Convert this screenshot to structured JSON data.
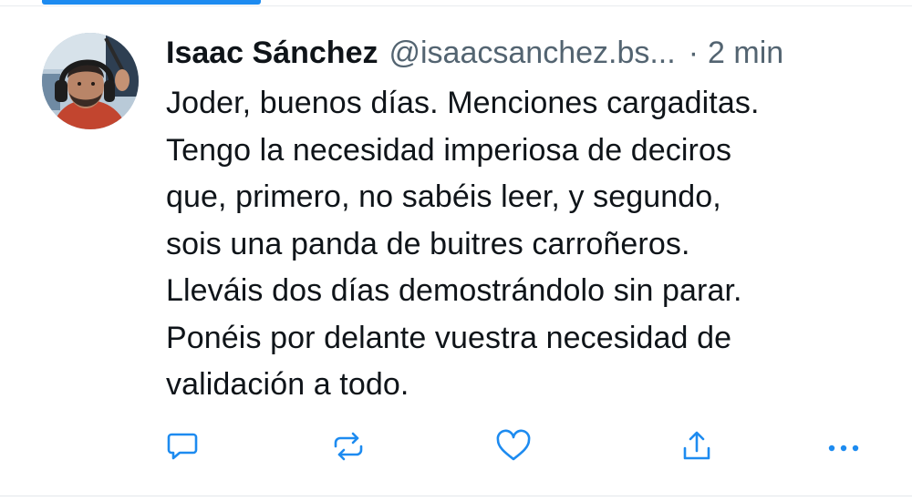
{
  "tweet": {
    "author_name": "Isaac Sánchez",
    "author_handle": "@isaacsanchez.bs...",
    "separator": "·",
    "time": "2 min",
    "lines": [
      "Joder, buenos días. Menciones cargaditas.",
      "Tengo la necesidad imperiosa de deciros",
      "que, primero, no sabéis leer, y segundo,",
      "sois una panda de buitres carroñeros.",
      "Lleváis dos días demostrándolo sin parar.",
      "Ponéis por delante vuestra necesidad de",
      "validación a todo."
    ]
  },
  "actions": {
    "icons": [
      "reply-icon",
      "repost-icon",
      "like-icon",
      "share-icon",
      "more-icon"
    ]
  },
  "colors": {
    "accent": "#1d8bf0",
    "text": "#0f1419",
    "secondary": "#536471",
    "icon": "#1d8bf0"
  }
}
